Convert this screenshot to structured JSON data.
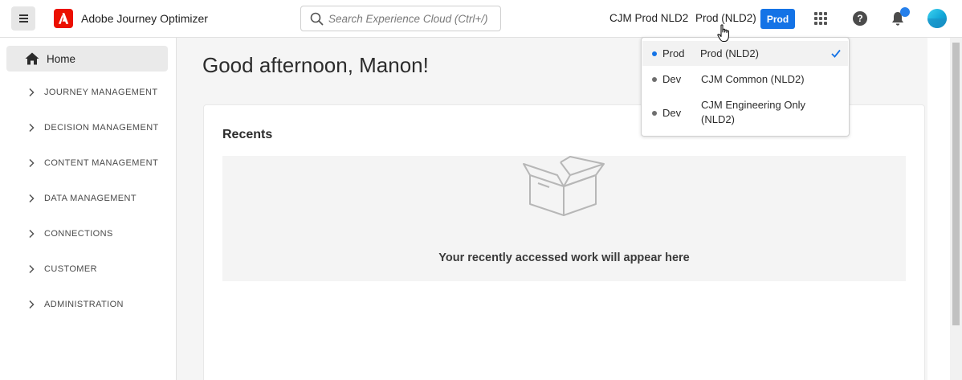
{
  "header": {
    "app_title": "Adobe Journey Optimizer",
    "search_placeholder": "Search Experience Cloud (Ctrl+/)",
    "org_name": "CJM Prod NLD2",
    "sandbox_name": "Prod (NLD2)",
    "sandbox_badge": "Prod",
    "help_symbol": "?"
  },
  "sidebar": {
    "home_label": "Home",
    "items": [
      {
        "label": "JOURNEY MANAGEMENT"
      },
      {
        "label": "DECISION MANAGEMENT"
      },
      {
        "label": "CONTENT MANAGEMENT"
      },
      {
        "label": "DATA MANAGEMENT"
      },
      {
        "label": "CONNECTIONS"
      },
      {
        "label": "CUSTOMER"
      },
      {
        "label": "ADMINISTRATION"
      }
    ]
  },
  "main": {
    "greeting": "Good afternoon, Manon!",
    "recents_title": "Recents",
    "empty_message": "Your recently accessed work will appear here"
  },
  "sandbox_dropdown": {
    "options": [
      {
        "env": "Prod",
        "name": "Prod (NLD2)",
        "selected": true,
        "dot_color": "#1473e6"
      },
      {
        "env": "Dev",
        "name": "CJM Common  (NLD2)",
        "selected": false,
        "dot_color": "#6e6e6e"
      },
      {
        "env": "Dev",
        "name": "CJM Engineering Only (NLD2)",
        "selected": false,
        "dot_color": "#6e6e6e"
      }
    ]
  },
  "colors": {
    "accent": "#1473e6",
    "adobe_red": "#eb1000",
    "notification": "#2680eb"
  }
}
